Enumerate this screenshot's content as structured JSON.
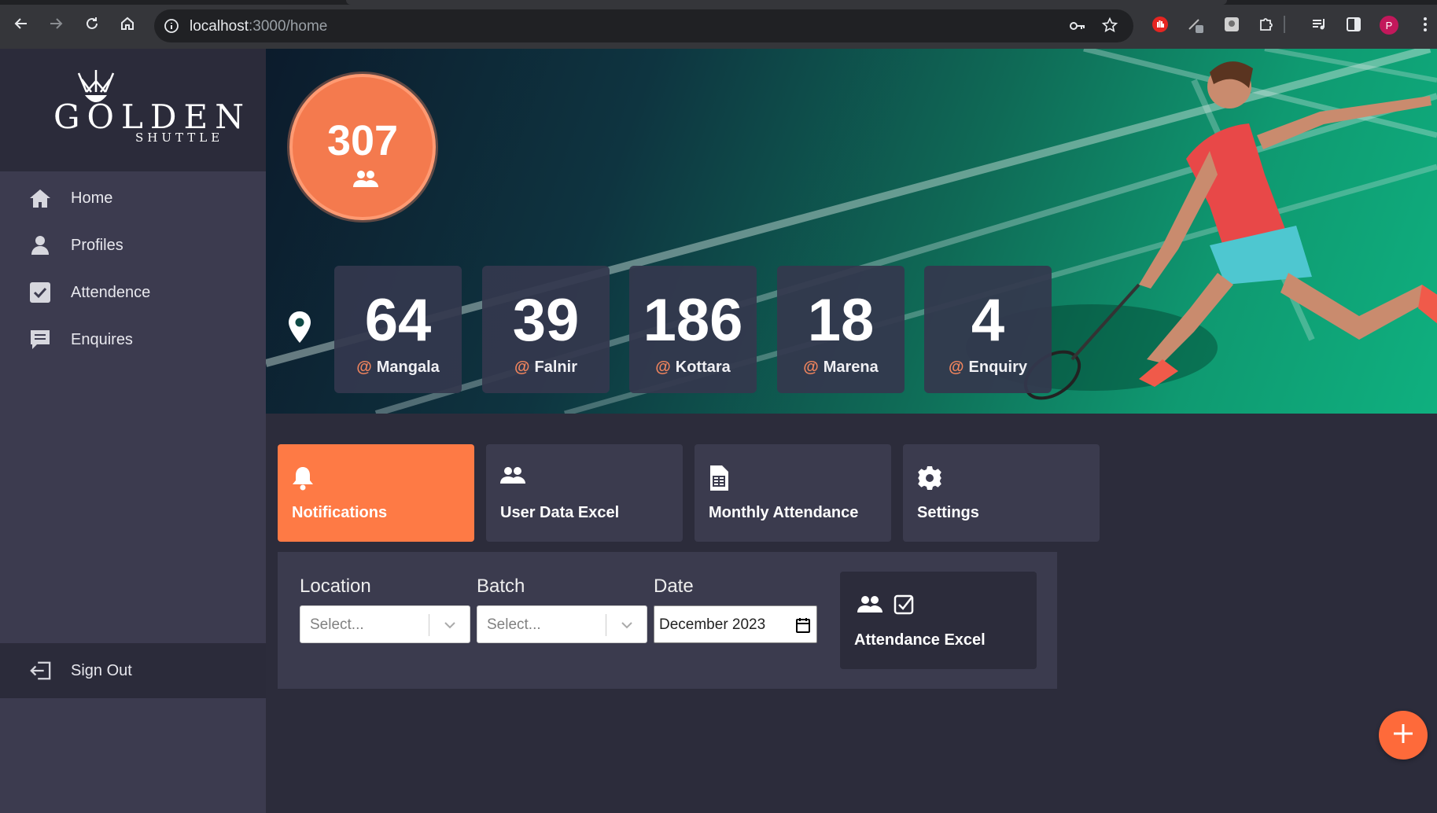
{
  "browser": {
    "url_host": "localhost",
    "url_path": ":3000/home",
    "profile_initial": "P"
  },
  "sidebar": {
    "logo": {
      "title": "GOLDEN",
      "subtitle": "SHUTTLE"
    },
    "items": [
      {
        "label": "Home",
        "icon": "home-icon"
      },
      {
        "label": "Profiles",
        "icon": "user-icon"
      },
      {
        "label": "Attendence",
        "icon": "checkbox-icon"
      },
      {
        "label": "Enquires",
        "icon": "message-icon"
      }
    ],
    "signout_label": "Sign Out"
  },
  "hero": {
    "total": "307",
    "stats": [
      {
        "value": "64",
        "label": "Mangala"
      },
      {
        "value": "39",
        "label": "Falnir"
      },
      {
        "value": "186",
        "label": "Kottara"
      },
      {
        "value": "18",
        "label": "Marena"
      },
      {
        "value": "4",
        "label": "Enquiry"
      }
    ],
    "at_symbol": "@"
  },
  "tiles": [
    {
      "label": "Notifications",
      "icon": "bell-icon",
      "active": true
    },
    {
      "label": "User Data Excel",
      "icon": "users-icon",
      "active": false
    },
    {
      "label": "Monthly Attendance",
      "icon": "spreadsheet-file-icon",
      "active": false
    },
    {
      "label": "Settings",
      "icon": "gear-icon",
      "active": false
    }
  ],
  "filter": {
    "location_label": "Location",
    "location_placeholder": "Select...",
    "batch_label": "Batch",
    "batch_placeholder": "Select...",
    "date_label": "Date",
    "date_value": "December 2023",
    "attendance_excel_label": "Attendance Excel"
  },
  "colors": {
    "accent": "#fe7a45",
    "sidebar": "#3c3b4f",
    "background": "#2c2c3b"
  }
}
